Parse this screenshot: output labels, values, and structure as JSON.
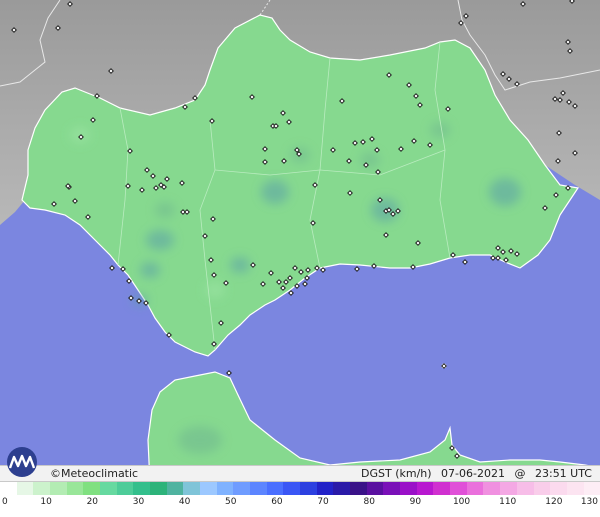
{
  "brand": "©Meteoclimatic",
  "info": {
    "variable": "DGST (km/h)",
    "date": "07-06-2021",
    "at": "@",
    "time": "23:51 UTC"
  },
  "legend": {
    "labels": [
      "0",
      "10",
      "20",
      "30",
      "40",
      "50",
      "60",
      "70",
      "80",
      "90",
      "100",
      "110",
      "120",
      "130"
    ],
    "colors": [
      "#ffffff",
      "#e6f7e6",
      "#ccf2cc",
      "#b3ecb3",
      "#99e699",
      "#80e080",
      "#66d9a0",
      "#4dcc99",
      "#33bf8c",
      "#2db37a",
      "#4fb3a0",
      "#7fc4d8",
      "#9cc8ff",
      "#7fb2ff",
      "#6f9cff",
      "#5c85ff",
      "#4a6fff",
      "#3a56f5",
      "#2c40e0",
      "#2222c8",
      "#2a1aa8",
      "#3a1288",
      "#5a10a0",
      "#7a10b8",
      "#9a10c8",
      "#b818d0",
      "#d030d0",
      "#e050d8",
      "#ea70dc",
      "#f090e0",
      "#f4a8e4",
      "#f7bde8",
      "#f9cdea",
      "#fbdaee",
      "#fce4f1",
      "#fdedf5"
    ]
  },
  "colors": {
    "sea": "#7b86e0",
    "land_andalucia": "#86d98f",
    "land_other": "#a8a8a8",
    "border": "#ffffff"
  },
  "stations": [
    [
      14,
      30
    ],
    [
      58,
      28
    ],
    [
      70,
      4
    ],
    [
      111,
      71
    ],
    [
      97,
      96
    ],
    [
      93,
      120
    ],
    [
      81,
      137
    ],
    [
      185,
      107
    ],
    [
      195,
      98
    ],
    [
      212,
      121
    ],
    [
      252,
      97
    ],
    [
      273,
      126
    ],
    [
      276,
      126
    ],
    [
      289,
      122
    ],
    [
      283,
      113
    ],
    [
      299,
      154
    ],
    [
      297,
      150
    ],
    [
      284,
      161
    ],
    [
      265,
      149
    ],
    [
      265,
      162
    ],
    [
      130,
      151
    ],
    [
      147,
      170
    ],
    [
      153,
      176
    ],
    [
      161,
      185
    ],
    [
      164,
      187
    ],
    [
      156,
      188
    ],
    [
      142,
      190
    ],
    [
      128,
      186
    ],
    [
      182,
      183
    ],
    [
      167,
      179
    ],
    [
      69,
      187
    ],
    [
      68,
      186
    ],
    [
      54,
      204
    ],
    [
      75,
      201
    ],
    [
      88,
      217
    ],
    [
      183,
      212
    ],
    [
      187,
      212
    ],
    [
      213,
      219
    ],
    [
      205,
      236
    ],
    [
      211,
      260
    ],
    [
      214,
      275
    ],
    [
      226,
      283
    ],
    [
      253,
      265
    ],
    [
      271,
      273
    ],
    [
      263,
      284
    ],
    [
      279,
      282
    ],
    [
      286,
      282
    ],
    [
      290,
      278
    ],
    [
      295,
      268
    ],
    [
      301,
      272
    ],
    [
      308,
      270
    ],
    [
      317,
      268
    ],
    [
      323,
      270
    ],
    [
      307,
      278
    ],
    [
      305,
      284
    ],
    [
      297,
      286
    ],
    [
      291,
      293
    ],
    [
      283,
      288
    ],
    [
      313,
      223
    ],
    [
      315,
      185
    ],
    [
      350,
      193
    ],
    [
      349,
      161
    ],
    [
      355,
      143
    ],
    [
      363,
      142
    ],
    [
      372,
      139
    ],
    [
      366,
      165
    ],
    [
      377,
      150
    ],
    [
      378,
      172
    ],
    [
      380,
      200
    ],
    [
      386,
      211
    ],
    [
      389,
      210
    ],
    [
      393,
      214
    ],
    [
      398,
      211
    ],
    [
      386,
      235
    ],
    [
      357,
      269
    ],
    [
      374,
      266
    ],
    [
      413,
      267
    ],
    [
      418,
      243
    ],
    [
      430,
      145
    ],
    [
      420,
      105
    ],
    [
      416,
      96
    ],
    [
      409,
      85
    ],
    [
      389,
      75
    ],
    [
      342,
      101
    ],
    [
      333,
      150
    ],
    [
      414,
      141
    ],
    [
      401,
      149
    ],
    [
      448,
      109
    ],
    [
      563,
      93
    ],
    [
      569,
      102
    ],
    [
      575,
      106
    ],
    [
      560,
      100
    ],
    [
      555,
      99
    ],
    [
      559,
      133
    ],
    [
      558,
      161
    ],
    [
      575,
      153
    ],
    [
      568,
      42
    ],
    [
      570,
      51
    ],
    [
      509,
      79
    ],
    [
      517,
      84
    ],
    [
      503,
      74
    ],
    [
      461,
      23
    ],
    [
      466,
      16
    ],
    [
      523,
      4
    ],
    [
      572,
      1
    ],
    [
      568,
      188
    ],
    [
      556,
      195
    ],
    [
      545,
      208
    ],
    [
      517,
      254
    ],
    [
      511,
      251
    ],
    [
      503,
      252
    ],
    [
      506,
      260
    ],
    [
      498,
      258
    ],
    [
      493,
      258
    ],
    [
      498,
      248
    ],
    [
      453,
      255
    ],
    [
      465,
      262
    ],
    [
      123,
      269
    ],
    [
      112,
      268
    ],
    [
      129,
      281
    ],
    [
      131,
      298
    ],
    [
      139,
      301
    ],
    [
      146,
      303
    ],
    [
      169,
      335
    ],
    [
      214,
      344
    ],
    [
      221,
      323
    ],
    [
      229,
      373
    ],
    [
      444,
      366
    ],
    [
      452,
      448
    ],
    [
      457,
      456
    ]
  ]
}
